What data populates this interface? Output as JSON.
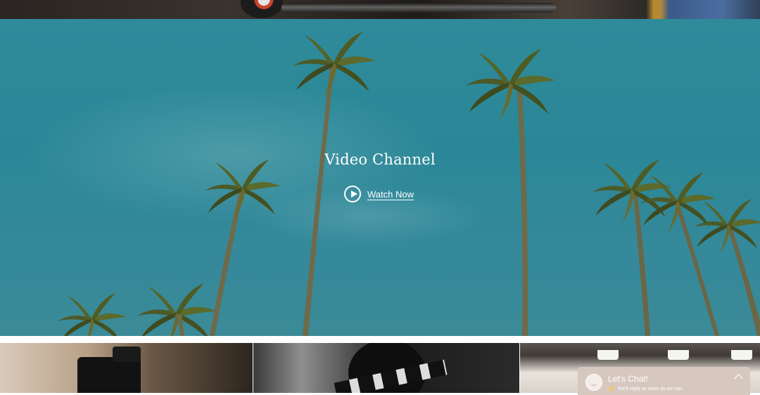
{
  "hero": {
    "title": "Video Channel",
    "cta_label": "Watch Now",
    "cta_icon": "play-circle-icon"
  },
  "chat": {
    "title": "Let's Chat!",
    "subtitle": "We'll reply as soon as we can",
    "icon": "bolt-icon",
    "toggle_icon": "chevron-up-icon"
  },
  "colors": {
    "sky": "#2f8b9a",
    "chat_bg": "#d7c8bf",
    "text": "#ffffff"
  }
}
